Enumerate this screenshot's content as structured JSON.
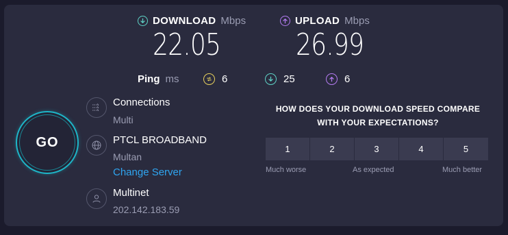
{
  "download": {
    "title": "DOWNLOAD",
    "unit": "Mbps",
    "value": "22.05",
    "color": "#5fd4c7"
  },
  "upload": {
    "title": "UPLOAD",
    "unit": "Mbps",
    "value": "26.99",
    "color": "#b57cf2"
  },
  "ping": {
    "label": "Ping",
    "unit": "ms",
    "idle": "6",
    "download": "25",
    "upload": "6",
    "idle_color": "#e8d15c"
  },
  "go_button": {
    "label": "GO",
    "accent": "#1eb6c8"
  },
  "connections": {
    "title": "Connections",
    "value": "Multi",
    "icon": "connections-icon"
  },
  "server": {
    "name": "PTCL BROADBAND",
    "location": "Multan",
    "change_link": "Change Server",
    "icon": "globe-icon"
  },
  "provider": {
    "name": "Multinet",
    "ip": "202.142.183.59",
    "icon": "user-icon"
  },
  "survey": {
    "question_line1": "HOW DOES YOUR DOWNLOAD SPEED COMPARE",
    "question_line2": "WITH YOUR EXPECTATIONS?",
    "options": [
      "1",
      "2",
      "3",
      "4",
      "5"
    ],
    "low_label": "Much worse",
    "mid_label": "As expected",
    "high_label": "Much better"
  }
}
